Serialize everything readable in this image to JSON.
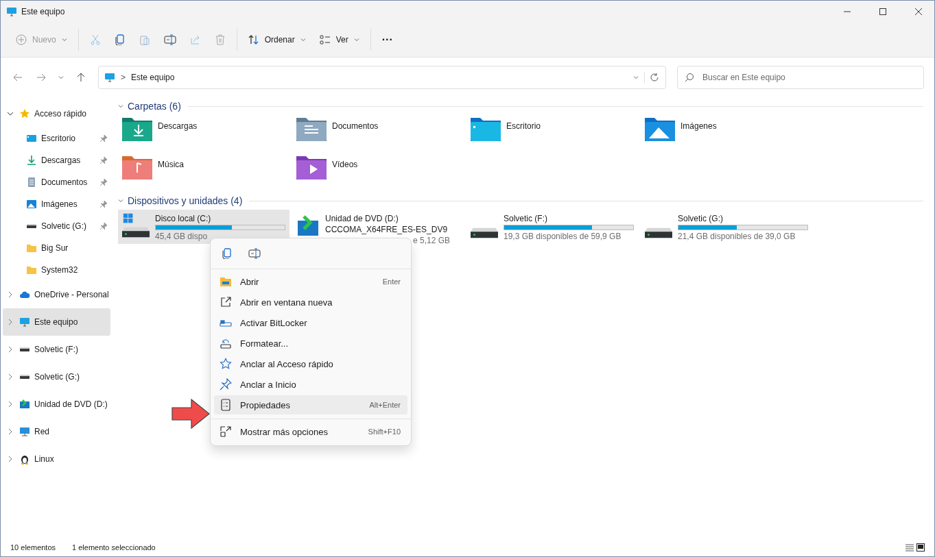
{
  "window": {
    "title": "Este equipo"
  },
  "toolbar": {
    "new": "Nuevo",
    "sort": "Ordenar",
    "view": "Ver",
    "more": "···"
  },
  "address": {
    "path": "Este equipo",
    "separator": ">"
  },
  "search": {
    "placeholder": "Buscar en Este equipo"
  },
  "sidebar": {
    "items": [
      {
        "label": "Acceso rápido",
        "kind": "star",
        "expanded": true,
        "selected": false,
        "children": [
          {
            "label": "Escritorio",
            "kind": "desktop",
            "pinned": true
          },
          {
            "label": "Descargas",
            "kind": "downloads",
            "pinned": true
          },
          {
            "label": "Documentos",
            "kind": "documents",
            "pinned": true
          },
          {
            "label": "Imágenes",
            "kind": "pictures",
            "pinned": true
          },
          {
            "label": "Solvetic (G:)",
            "kind": "drive",
            "pinned": true
          },
          {
            "label": "Big Sur",
            "kind": "folder",
            "pinned": false
          },
          {
            "label": "System32",
            "kind": "folder",
            "pinned": false
          }
        ]
      },
      {
        "label": "OneDrive - Personal",
        "kind": "cloud",
        "expanded": false,
        "selected": false
      },
      {
        "label": "Este equipo",
        "kind": "pc",
        "expanded": false,
        "selected": true
      },
      {
        "label": "Solvetic (F:)",
        "kind": "drive",
        "expanded": false,
        "selected": false
      },
      {
        "label": "Solvetic (G:)",
        "kind": "drive",
        "expanded": false,
        "selected": false
      },
      {
        "label": "Unidad de DVD (D:)",
        "kind": "dvd",
        "expanded": false,
        "selected": false
      },
      {
        "label": "Red",
        "kind": "network",
        "expanded": false,
        "selected": false
      },
      {
        "label": "Linux",
        "kind": "linux",
        "expanded": false,
        "selected": false
      }
    ]
  },
  "folders": {
    "heading": "Carpetas (6)",
    "items": [
      {
        "name": "Descargas",
        "kind": "downloads"
      },
      {
        "name": "Documentos",
        "kind": "documents"
      },
      {
        "name": "Escritorio",
        "kind": "desktop"
      },
      {
        "name": "Imágenes",
        "kind": "pictures"
      },
      {
        "name": "Música",
        "kind": "music"
      },
      {
        "name": "Vídeos",
        "kind": "videos"
      }
    ]
  },
  "devices": {
    "heading": "Dispositivos y unidades (4)",
    "items": [
      {
        "name": "Disco local (C:)",
        "kind": "system",
        "level": 0.59,
        "detail": "45,4 GB dispo",
        "selected": true
      },
      {
        "name": "Unidad de DVD (D:)",
        "kind": "dvd",
        "volume": "CCCOMA_X64FRE_ES-ES_DV9",
        "detail": "e 5,12 GB",
        "selected": false
      },
      {
        "name": "Solvetic (F:)",
        "kind": "disk",
        "level": 0.68,
        "detail": "19,3 GB disponibles de 59,9 GB",
        "selected": false
      },
      {
        "name": "Solvetic (G:)",
        "kind": "disk",
        "level": 0.45,
        "detail": "21,4 GB disponibles de 39,0 GB",
        "selected": false
      }
    ]
  },
  "context_menu": {
    "items": [
      {
        "label": "Abrir",
        "kind": "open",
        "shortcut": "Enter",
        "selected": false
      },
      {
        "label": "Abrir en ventana nueva",
        "kind": "newwindow",
        "selected": false
      },
      {
        "label": "Activar BitLocker",
        "kind": "lock",
        "selected": false
      },
      {
        "label": "Formatear...",
        "kind": "format",
        "selected": false
      },
      {
        "label": "Anclar al Acceso rápido",
        "kind": "star",
        "selected": false
      },
      {
        "label": "Anclar a Inicio",
        "kind": "pin",
        "selected": false
      },
      {
        "label": "Propiedades",
        "kind": "props",
        "shortcut": "Alt+Enter",
        "selected": true
      },
      {
        "label": "Mostrar más opciones",
        "kind": "more",
        "shortcut": "Shift+F10",
        "selected": false,
        "separated": true
      }
    ]
  },
  "status_bar": {
    "count": "10 elementos",
    "selection": "1 elemento seleccionado"
  }
}
